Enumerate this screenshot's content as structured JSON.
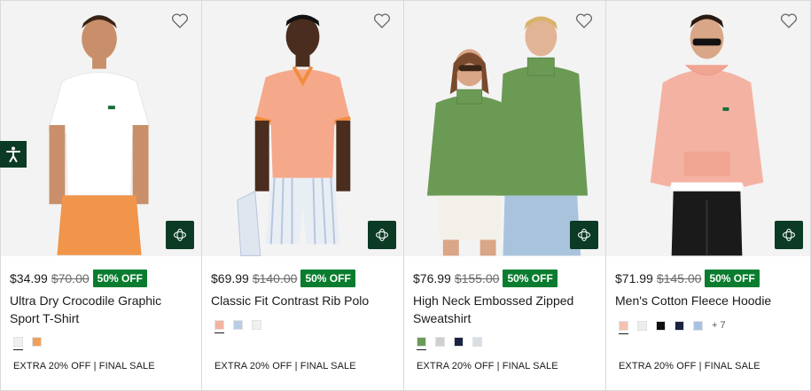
{
  "products": [
    {
      "price": "$34.99",
      "old_price": "$70.00",
      "discount": "50% OFF",
      "title": "Ultra Dry Crocodile Graphic Sport T-Shirt",
      "swatches": [
        "#f0f0f0",
        "#f0a05c"
      ],
      "more": "",
      "promo": "EXTRA 20% OFF | FINAL SALE"
    },
    {
      "price": "$69.99",
      "old_price": "$140.00",
      "discount": "50% OFF",
      "title": "Classic Fit Contrast Rib Polo",
      "swatches": [
        "#f2b3a0",
        "#b8cde6",
        "#f0f0f0"
      ],
      "more": "",
      "promo": "EXTRA 20% OFF | FINAL SALE"
    },
    {
      "price": "$76.99",
      "old_price": "$155.00",
      "discount": "50% OFF",
      "title": "High Neck Embossed Zipped Sweatshirt",
      "swatches": [
        "#6b9a55",
        "#cfcfcf",
        "#1a2340",
        "#d9dde6"
      ],
      "more": "",
      "promo": "EXTRA 20% OFF | FINAL SALE"
    },
    {
      "price": "$71.99",
      "old_price": "$145.00",
      "discount": "50% OFF",
      "title": "Men's Cotton Fleece Hoodie",
      "swatches": [
        "#f4c1b3",
        "#eeeeee",
        "#111111",
        "#1a2340",
        "#a9c0e6"
      ],
      "more": "+ 7",
      "promo": "EXTRA 20% OFF | FINAL SALE"
    }
  ],
  "colors": {
    "badge": "#0a7c2f",
    "dark_green": "#0b3b24"
  }
}
